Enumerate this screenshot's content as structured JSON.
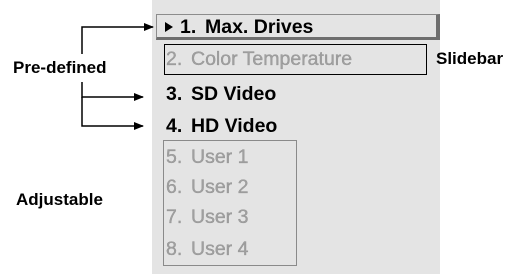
{
  "menu": {
    "items": [
      {
        "number": "1.",
        "label": "Max. Drives",
        "state": "selected"
      },
      {
        "number": "2.",
        "label": "Color Temperature",
        "state": "disabled"
      },
      {
        "number": "3.",
        "label": "SD Video",
        "state": "enabled"
      },
      {
        "number": "4.",
        "label": "HD Video",
        "state": "enabled"
      },
      {
        "number": "5.",
        "label": "User 1",
        "state": "disabled"
      },
      {
        "number": "6.",
        "label": "User 2",
        "state": "disabled"
      },
      {
        "number": "7.",
        "label": "User 3",
        "state": "disabled"
      },
      {
        "number": "8.",
        "label": "User 4",
        "state": "disabled"
      }
    ]
  },
  "annotations": {
    "predefined": "Pre-defined",
    "slidebar": "Slidebar",
    "adjustable": "Adjustable"
  },
  "icons": {
    "selection_marker": "right-triangle-icon"
  },
  "colors": {
    "panel_background": "#e4e4e4",
    "enabled_text": "#000000",
    "disabled_text": "#a0a0a0"
  }
}
